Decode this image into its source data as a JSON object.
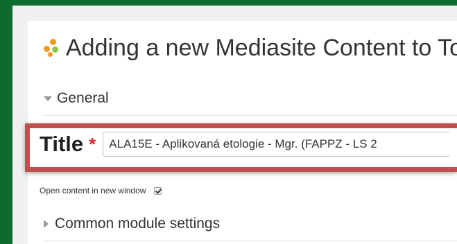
{
  "page": {
    "title": "Adding a new Mediasite Content to Top",
    "icon": "mediasite-module-icon"
  },
  "sections": {
    "general": {
      "label": "General",
      "expanded": true
    },
    "common_module_settings": {
      "label": "Common module settings",
      "expanded": false
    }
  },
  "form": {
    "title_field": {
      "label": "Title",
      "required_marker": "*",
      "value": "ALA15E - Aplikovaná etologie - Mgr. (FAPPZ - LS 2"
    },
    "open_new_window": {
      "label": "Open content in new window",
      "checked": true
    }
  },
  "colors": {
    "frame_border": "#0e6b2f",
    "highlight_border": "#c0504d",
    "required": "#d9262b",
    "icon_orange": "#f39a1e",
    "icon_green": "#8cc63f"
  }
}
